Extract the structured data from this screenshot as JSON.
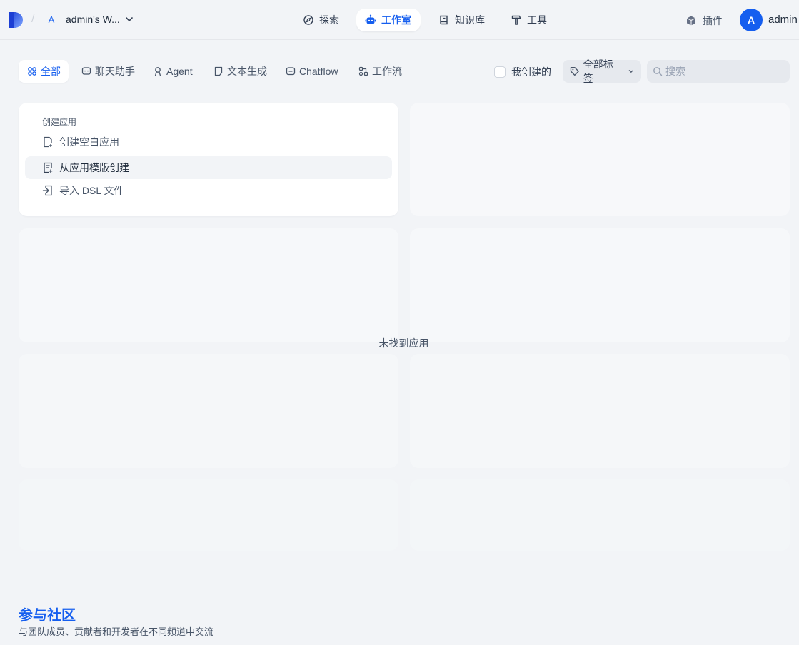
{
  "header": {
    "breadcrumb_separator": "/",
    "workspace_initial": "A",
    "workspace_name": "admin's W...",
    "nav": {
      "explore": "探索",
      "studio": "工作室",
      "datasets": "知识库",
      "tools": "工具"
    },
    "plugins_label": "插件",
    "user_initial": "A",
    "user_name": "admin"
  },
  "filters": {
    "tabs": {
      "all": "全部",
      "chat": "聊天助手",
      "agent": "Agent",
      "completion": "文本生成",
      "chatflow": "Chatflow",
      "workflow": "工作流"
    },
    "created_by_me": "我创建的",
    "all_tags": "全部标签",
    "search_placeholder": "搜索"
  },
  "create_card": {
    "title": "创建应用",
    "items": {
      "blank": "创建空白应用",
      "template": "从应用模版创建",
      "import": "导入 DSL 文件"
    }
  },
  "empty_state": "未找到应用",
  "footer": {
    "title": "参与社区",
    "description": "与团队成员、贡献者和开发者在不同频道中交流"
  },
  "colors": {
    "accent": "#155eef",
    "background": "#f2f4f7"
  }
}
